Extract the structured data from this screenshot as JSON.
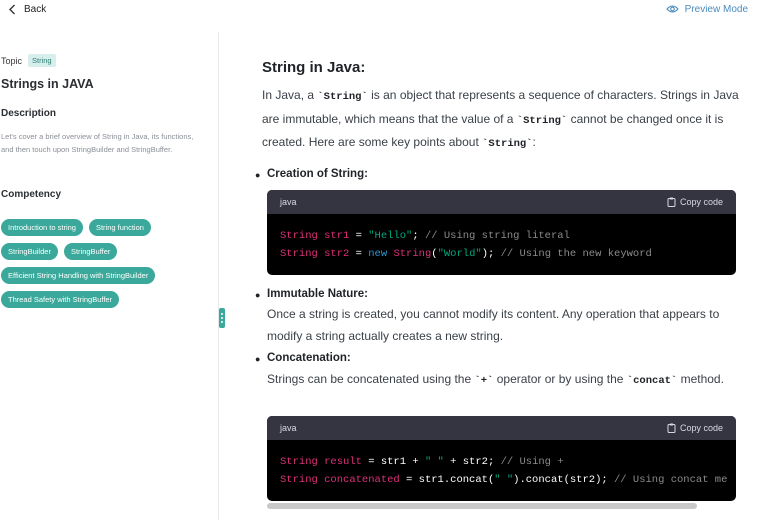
{
  "topbar": {
    "back_label": "Back",
    "preview_label": "Preview Mode"
  },
  "sidebar": {
    "topic_label": "Topic",
    "topic_badge": "String",
    "title": "Strings in JAVA",
    "description_heading": "Description",
    "description": "Let's cover a brief overview of String in Java, its functions, and then touch upon StringBuilder and StringBuffer.",
    "competency_heading": "Competency",
    "chips": [
      "Introduction to string",
      "String function",
      "StringBuilder",
      "StringBuffer",
      "Efficient String Handling with StringBuilder",
      "Thread Safety with StringBuffer"
    ]
  },
  "main": {
    "heading": "String in Java:",
    "intro": {
      "t1": "In Java, a ",
      "c1": "`String`",
      "t2": " is an object that represents a sequence of characters. Strings in Java are immutable, which means that the value of a ",
      "c2": "`String`",
      "t3": " cannot be changed once it is created. Here are some key points about ",
      "c3": "`String`",
      "t4": ":"
    },
    "items": [
      {
        "heading": "Creation of String:"
      },
      {
        "heading": "Immutable Nature:",
        "text": "Once a string is created, you cannot modify its content. Any operation that appears to modify a string actually creates a new string."
      },
      {
        "heading": "Concatenation:",
        "t1": "Strings can be concatenated using the ",
        "c1": "`+`",
        "t2": " operator or by using the ",
        "c2": "`concat`",
        "t3": " method."
      }
    ],
    "code_blocks": [
      {
        "lang": "java",
        "copy_label": "Copy code",
        "lines": [
          [
            {
              "c": "kw",
              "t": "String"
            },
            {
              "c": "kw",
              "t": " str1"
            },
            {
              "c": "",
              "t": " = "
            },
            {
              "c": "str",
              "t": "\"Hello\""
            },
            {
              "c": "",
              "t": "; "
            },
            {
              "c": "cm",
              "t": "// Using string literal"
            }
          ],
          [
            {
              "c": "kw",
              "t": "String"
            },
            {
              "c": "kw",
              "t": " str2"
            },
            {
              "c": "",
              "t": " = "
            },
            {
              "c": "nw",
              "t": "new"
            },
            {
              "c": "",
              "t": " "
            },
            {
              "c": "kw",
              "t": "String"
            },
            {
              "c": "",
              "t": "("
            },
            {
              "c": "str",
              "t": "\"World\""
            },
            {
              "c": "",
              "t": "); "
            },
            {
              "c": "cm",
              "t": "// Using the new keyword"
            }
          ]
        ]
      },
      {
        "lang": "java",
        "copy_label": "Copy code",
        "lines": [
          [
            {
              "c": "kw",
              "t": "String"
            },
            {
              "c": "kw",
              "t": " result"
            },
            {
              "c": "",
              "t": " = str1 + "
            },
            {
              "c": "str",
              "t": "\" \""
            },
            {
              "c": "",
              "t": " + str2; "
            },
            {
              "c": "cm",
              "t": "// Using +"
            }
          ],
          [
            {
              "c": "kw",
              "t": "String"
            },
            {
              "c": "kw",
              "t": " concatenated"
            },
            {
              "c": "",
              "t": " = str1.concat("
            },
            {
              "c": "str",
              "t": "\" \""
            },
            {
              "c": "",
              "t": ").concat(str2); "
            },
            {
              "c": "cm",
              "t": "// Using concat me"
            }
          ]
        ]
      }
    ]
  },
  "colors": {
    "accent": "#3aa89a",
    "link": "#4a8bbd",
    "code_bg": "#000000",
    "code_header_bg": "#343541"
  }
}
